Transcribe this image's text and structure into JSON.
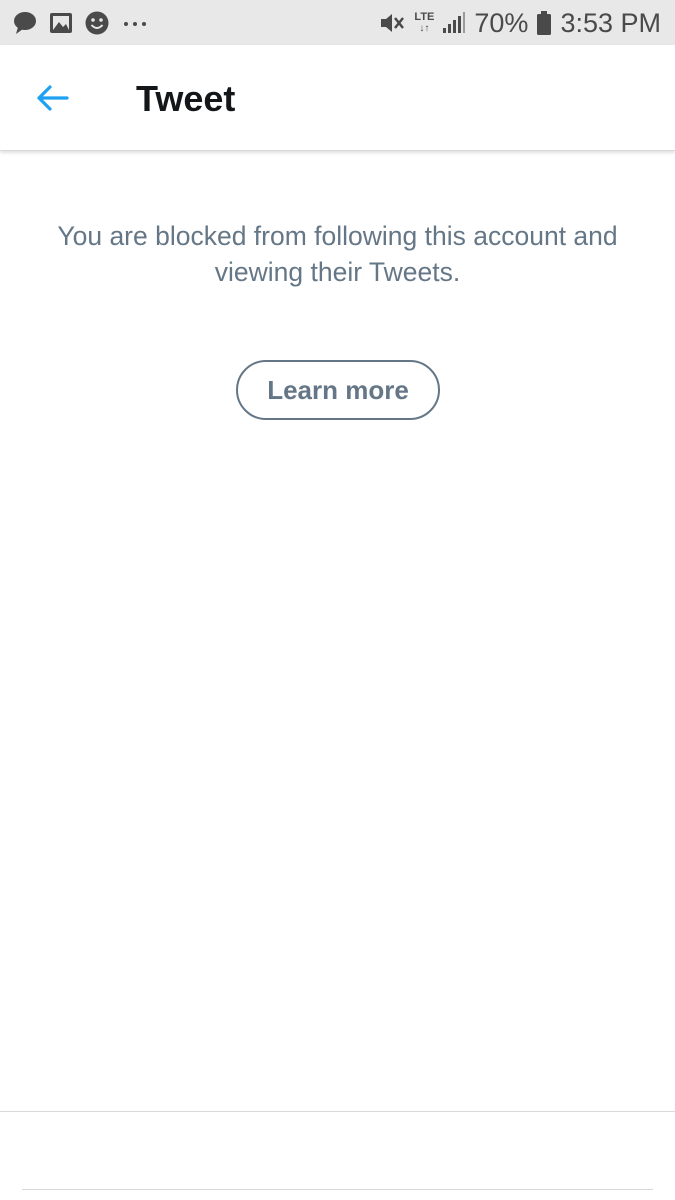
{
  "status_bar": {
    "battery_percent": "70%",
    "time": "3:53 PM",
    "network": "LTE",
    "left_icons": [
      "message-icon",
      "image-icon",
      "smiley-icon",
      "more-dots-icon"
    ],
    "right_icons": [
      "mute-vibrate-icon",
      "lte-icon",
      "signal-icon",
      "battery-icon"
    ]
  },
  "header": {
    "title": "Tweet",
    "back_icon": "arrow-left-icon",
    "accent_color": "#1da1f2"
  },
  "main": {
    "message": "You are blocked from following this account and viewing their Tweets.",
    "learn_more_label": "Learn more",
    "text_color": "#657786"
  }
}
